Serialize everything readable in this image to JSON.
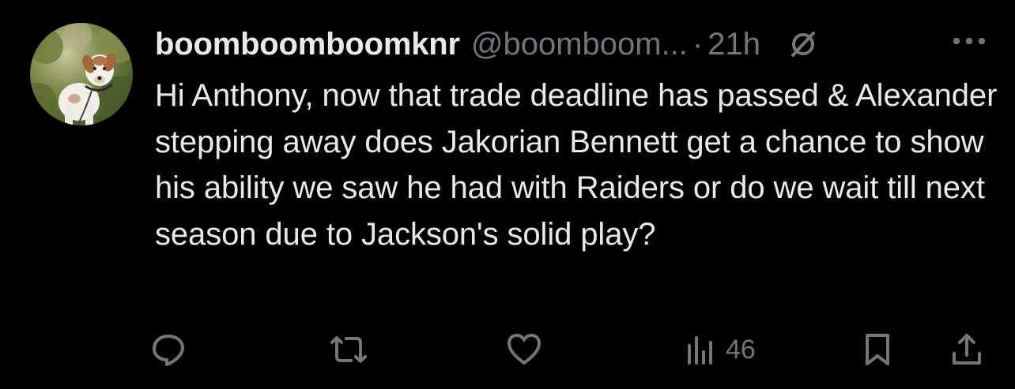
{
  "author": {
    "display_name": "boomboomboomknr",
    "handle": "@boomboom...",
    "separator": "·",
    "timestamp": "21h"
  },
  "tweet": {
    "text": "Hi Anthony, now that trade deadline has passed & Alexander stepping away does Jakorian Bennett get a chance to show his ability we saw he had with Raiders or do we wait till next season due to Jackson's solid play?"
  },
  "actions": {
    "views": "46"
  },
  "icons": {
    "muted": "muted-circle-slash-icon",
    "more": "more-dots-icon",
    "reply": "reply-icon",
    "retweet": "retweet-icon",
    "like": "heart-icon",
    "views": "views-chart-icon",
    "bookmark": "bookmark-icon",
    "share": "share-icon"
  },
  "colors": {
    "background": "#000000",
    "text_primary": "#e7e9ea",
    "text_secondary": "#71767b"
  }
}
